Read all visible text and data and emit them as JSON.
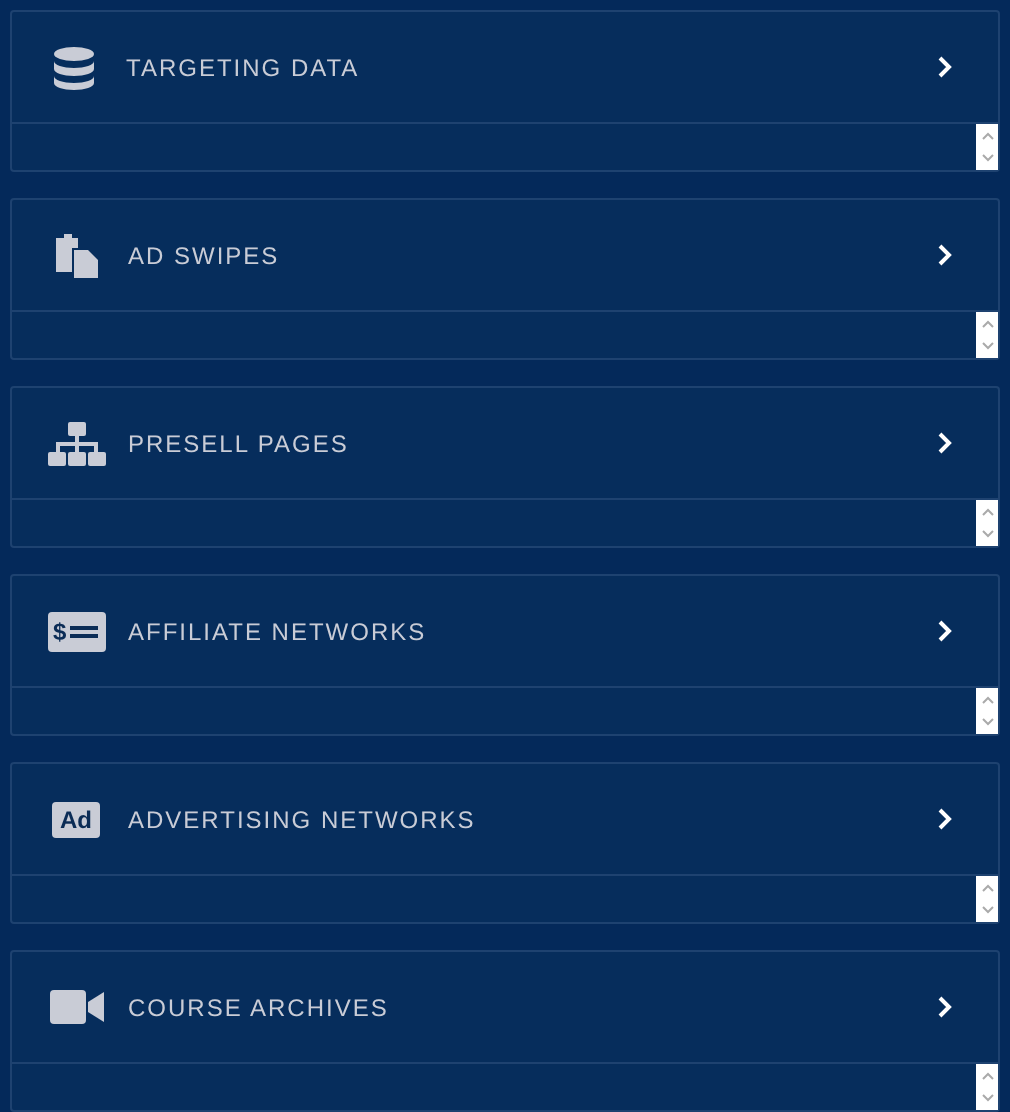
{
  "sections": [
    {
      "title": "TARGETING DATA"
    },
    {
      "title": "AD SWIPES"
    },
    {
      "title": "PRESELL PAGES"
    },
    {
      "title": "AFFILIATE NETWORKS",
      "icon_text": "$"
    },
    {
      "title": "ADVERTISING NETWORKS",
      "icon_text": "Ad"
    },
    {
      "title": "COURSE ARCHIVES"
    }
  ]
}
